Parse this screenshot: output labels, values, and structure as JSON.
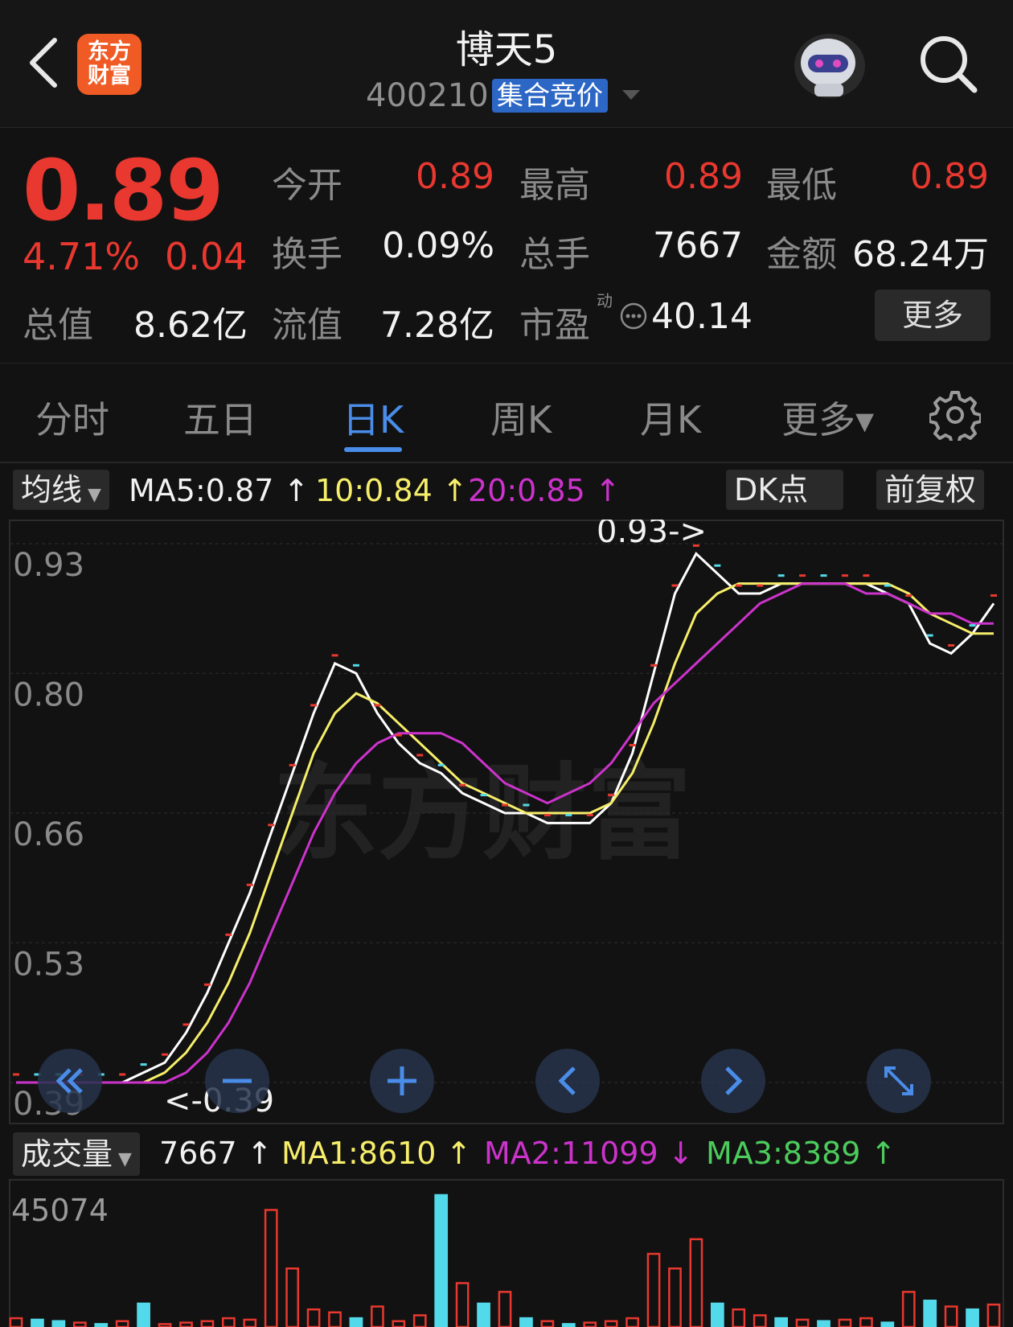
{
  "header": {
    "title": "博天5",
    "code": "400210",
    "tag": "集合竞价",
    "logo_text": "东方财富"
  },
  "quote": {
    "price": "0.89",
    "change_pct": "4.71%",
    "change": "0.04",
    "stats": [
      {
        "label": "今开",
        "value": "0.89",
        "color": "red"
      },
      {
        "label": "最高",
        "value": "0.89",
        "color": "red"
      },
      {
        "label": "最低",
        "value": "0.89",
        "color": "red"
      },
      {
        "label": "换手",
        "value": "0.09%",
        "color": "white"
      },
      {
        "label": "总手",
        "value": "7667",
        "color": "white"
      },
      {
        "label": "金额",
        "value": "68.24万",
        "color": "white"
      },
      {
        "label": "总值",
        "value": "8.62亿",
        "color": "white"
      },
      {
        "label": "流值",
        "value": "7.28亿",
        "color": "white"
      },
      {
        "label": "市盈",
        "value": "40.14",
        "color": "white"
      }
    ],
    "pe_superscript": "动",
    "more_label": "更多"
  },
  "tabs": [
    {
      "label": "分时"
    },
    {
      "label": "五日"
    },
    {
      "label": "日K",
      "active": true
    },
    {
      "label": "周K"
    },
    {
      "label": "月K"
    },
    {
      "label": "更多▾"
    }
  ],
  "ma_row": {
    "dropdown": "均线",
    "ma5": "MA5:0.87",
    "ma10": "10:0.84",
    "ma20": "20:0.85",
    "arrow_up": "↑",
    "dk_button": "DK点",
    "adjust_button": "前复权"
  },
  "price_axis": [
    "0.93",
    "0.80",
    "0.66",
    "0.53",
    "0.39"
  ],
  "annotations": {
    "high": "0.93->",
    "low": "<-0.39"
  },
  "watermark": "东方财富",
  "volume_row": {
    "dropdown": "成交量",
    "value": "7667",
    "arrow_up": "↑",
    "arrow_down": "↓",
    "ma1": "MA1:8610",
    "ma2": "MA2:11099",
    "ma3": "MA3:8389"
  },
  "volume_axis_top": "45074",
  "colors": {
    "up": "#e8382f",
    "down": "#52d9ea",
    "ma5": "#ffffff",
    "ma10": "#f6ee6a",
    "ma20": "#cc33cc",
    "ma3_vol": "#4ccc5c",
    "accent": "#4a8de8"
  },
  "chart_data": {
    "type": "line",
    "ylim": [
      0.39,
      0.93
    ],
    "series": [
      {
        "name": "MA5",
        "values": [
          0.39,
          0.39,
          0.39,
          0.39,
          0.39,
          0.39,
          0.4,
          0.41,
          0.44,
          0.48,
          0.53,
          0.58,
          0.64,
          0.7,
          0.76,
          0.81,
          0.8,
          0.76,
          0.73,
          0.71,
          0.7,
          0.68,
          0.67,
          0.66,
          0.66,
          0.65,
          0.65,
          0.65,
          0.67,
          0.72,
          0.8,
          0.88,
          0.92,
          0.9,
          0.88,
          0.88,
          0.89,
          0.89,
          0.89,
          0.89,
          0.89,
          0.88,
          0.87,
          0.83,
          0.82,
          0.84,
          0.87
        ]
      },
      {
        "name": "10",
        "values": [
          0.39,
          0.39,
          0.39,
          0.39,
          0.39,
          0.39,
          0.39,
          0.4,
          0.42,
          0.45,
          0.49,
          0.54,
          0.6,
          0.66,
          0.72,
          0.76,
          0.78,
          0.77,
          0.75,
          0.73,
          0.71,
          0.69,
          0.68,
          0.67,
          0.66,
          0.66,
          0.66,
          0.66,
          0.67,
          0.7,
          0.75,
          0.81,
          0.86,
          0.88,
          0.89,
          0.89,
          0.89,
          0.89,
          0.89,
          0.89,
          0.89,
          0.89,
          0.88,
          0.86,
          0.85,
          0.84,
          0.84
        ]
      },
      {
        "name": "20",
        "values": [
          0.39,
          0.39,
          0.39,
          0.39,
          0.39,
          0.39,
          0.39,
          0.39,
          0.4,
          0.42,
          0.45,
          0.49,
          0.54,
          0.59,
          0.64,
          0.68,
          0.71,
          0.73,
          0.74,
          0.74,
          0.74,
          0.73,
          0.71,
          0.69,
          0.68,
          0.67,
          0.68,
          0.69,
          0.71,
          0.74,
          0.77,
          0.79,
          0.81,
          0.83,
          0.85,
          0.87,
          0.88,
          0.89,
          0.89,
          0.89,
          0.88,
          0.88,
          0.87,
          0.86,
          0.86,
          0.85,
          0.85
        ]
      }
    ],
    "volume": [
      3000,
      2500,
      2000,
      1500,
      1000,
      2000,
      8000,
      1000,
      1500,
      2000,
      3000,
      2500,
      40000,
      20000,
      6000,
      5000,
      3000,
      7000,
      2000,
      4000,
      45074,
      15000,
      8000,
      12000,
      3000,
      2000,
      1000,
      1500,
      2000,
      3000,
      25000,
      20000,
      30000,
      8000,
      6000,
      4000,
      3000,
      2500,
      2000,
      2500,
      3000,
      1500,
      12000,
      9000,
      7000,
      6000,
      7667
    ],
    "volume_up": [
      true,
      false,
      false,
      true,
      false,
      true,
      false,
      true,
      true,
      true,
      true,
      true,
      true,
      true,
      true,
      true,
      false,
      true,
      true,
      true,
      false,
      true,
      false,
      true,
      false,
      true,
      false,
      true,
      true,
      true,
      true,
      true,
      true,
      false,
      true,
      true,
      false,
      true,
      false,
      true,
      true,
      false,
      true,
      false,
      true,
      false,
      true
    ]
  }
}
